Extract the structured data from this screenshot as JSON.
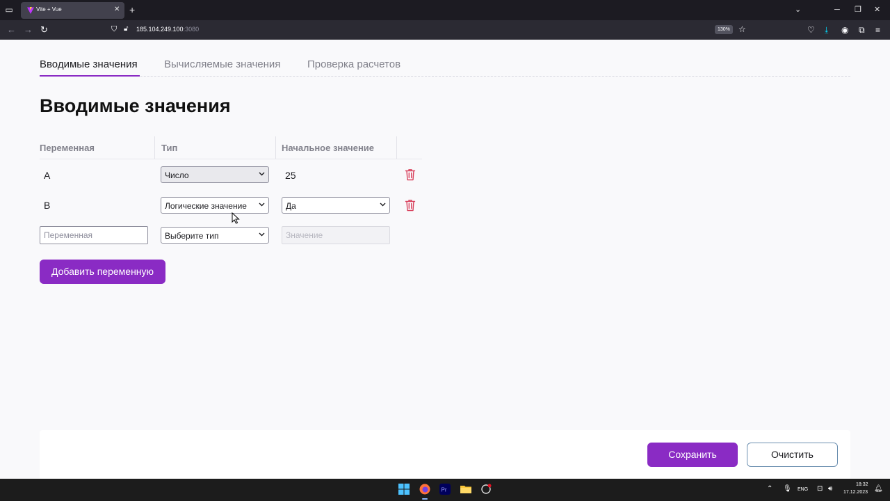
{
  "browser": {
    "tab_title": "Vite + Vue",
    "url_host": "185.104.249.100",
    "url_port": ":3080",
    "zoom": "130%"
  },
  "page": {
    "tabs": [
      {
        "label": "Вводимые значения"
      },
      {
        "label": "Вычисляемые значения"
      },
      {
        "label": "Проверка расчетов"
      }
    ],
    "title": "Вводимые значения",
    "columns": [
      "Переменная",
      "Тип",
      "Начальное значение"
    ],
    "rows": [
      {
        "name": "A",
        "type": "Число",
        "value": "25"
      },
      {
        "name": "B",
        "type": "Логические значение",
        "value": "Да"
      }
    ],
    "new_row": {
      "name_placeholder": "Переменная",
      "type_placeholder": "Выберите тип",
      "value_placeholder": "Значение"
    },
    "add_button": "Добавить переменную"
  },
  "footer": {
    "save_button": "Сохранить",
    "clear_button": "Очистить"
  },
  "taskbar": {
    "language": "ENG",
    "time": "18:32",
    "date": "17.12.2023"
  },
  "colors": {
    "accent": "#8a2bc4",
    "trash": "#d9435e"
  }
}
